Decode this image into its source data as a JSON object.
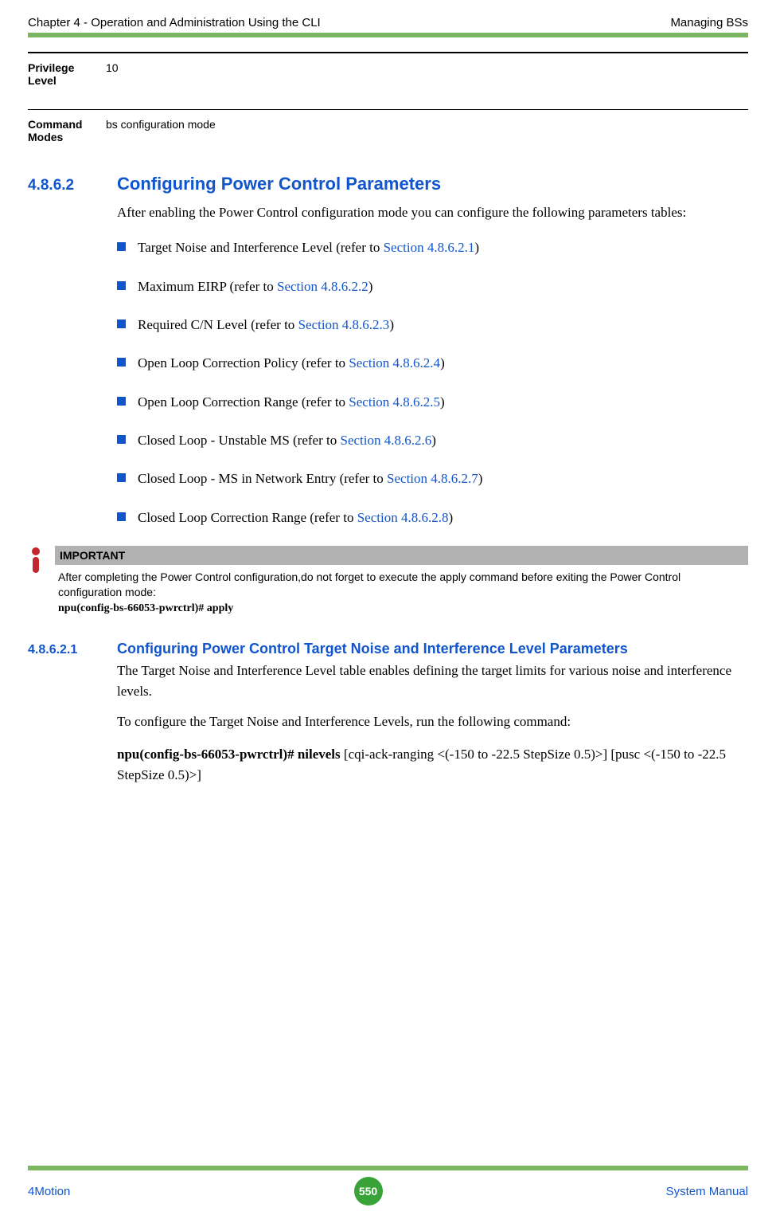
{
  "header": {
    "left": "Chapter 4 - Operation and Administration Using the CLI",
    "right": "Managing BSs"
  },
  "meta": {
    "privilege_label": "Privilege Level",
    "privilege_value": "10",
    "modes_label": "Command Modes",
    "modes_value": "bs configuration mode"
  },
  "section1": {
    "num": "4.8.6.2",
    "title": "Configuring Power Control Parameters",
    "intro": "After enabling the Power Control configuration mode you can configure the following parameters tables:"
  },
  "bullets": [
    {
      "pre": "Target Noise and Interference Level (refer to ",
      "link": "Section 4.8.6.2.1",
      "post": ")"
    },
    {
      "pre": "Maximum EIRP (refer to ",
      "link": "Section 4.8.6.2.2",
      "post": ")"
    },
    {
      "pre": "Required C/N Level (refer to ",
      "link": "Section 4.8.6.2.3",
      "post": ")"
    },
    {
      "pre": "Open Loop Correction Policy (refer to ",
      "link": "Section 4.8.6.2.4",
      "post": ")"
    },
    {
      "pre": "Open Loop Correction Range (refer to ",
      "link": "Section 4.8.6.2.5",
      "post": ")"
    },
    {
      "pre": "Closed Loop - Unstable MS (refer to ",
      "link": "Section 4.8.6.2.6",
      "post": ")"
    },
    {
      "pre": "Closed Loop - MS in Network Entry (refer to ",
      "link": "Section 4.8.6.2.7",
      "post": ")"
    },
    {
      "pre": "Closed Loop Correction Range (refer to ",
      "link": "Section 4.8.6.2.8",
      "post": ")"
    }
  ],
  "note": {
    "title": "IMPORTANT",
    "text": "After completing the Power Control configuration,do not forget to execute the apply command before exiting the Power Control configuration mode:",
    "cmd": "npu(config-bs-66053-pwrctrl)# apply"
  },
  "section2": {
    "num": "4.8.6.2.1",
    "title": "Configuring Power Control Target Noise and Interference Level Parameters",
    "p1": "The Target Noise and Interference Level table enables defining the target limits for various noise and interference levels.",
    "p2": "To configure the Target Noise and Interference Levels, run the following command:",
    "cmd_bold": "npu(config-bs-66053-pwrctrl)# nilevels",
    "cmd_rest": " [cqi-ack-ranging <(-150 to -22.5 StepSize 0.5)>] [pusc <(-150 to -22.5 StepSize 0.5)>]"
  },
  "footer": {
    "left": "4Motion",
    "page": "550",
    "right": "System Manual"
  }
}
